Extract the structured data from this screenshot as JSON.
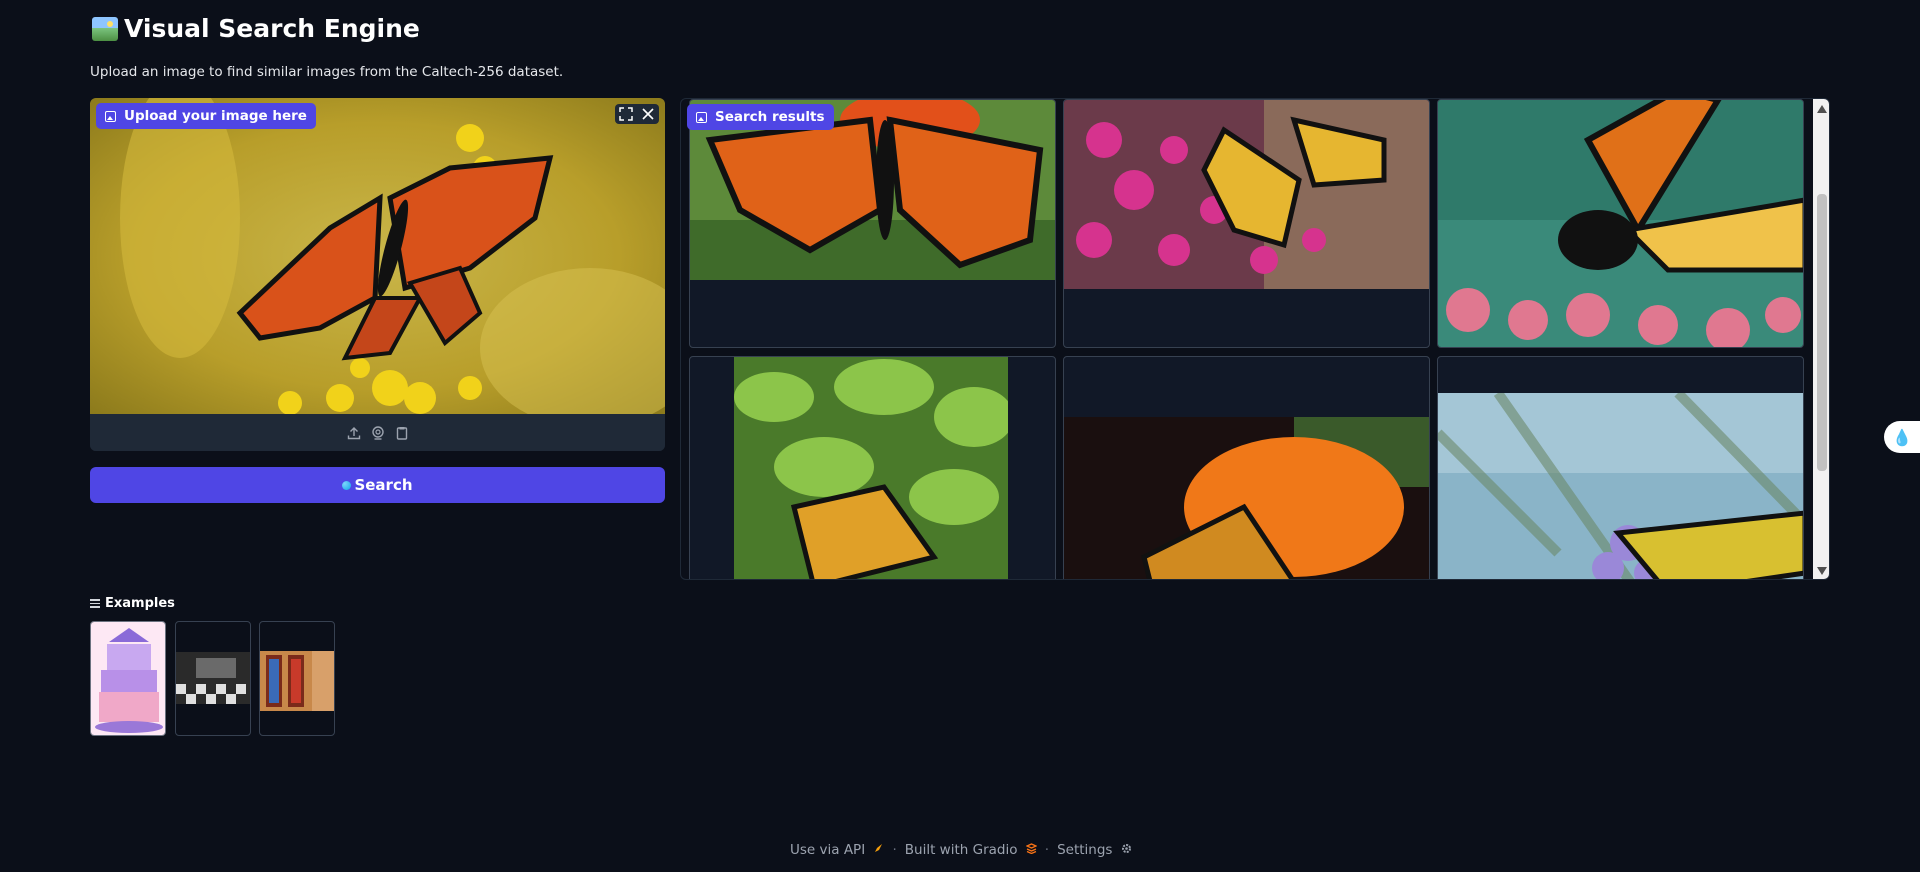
{
  "header": {
    "title": "Visual Search Engine",
    "icon": "framed-picture-icon",
    "subtitle": "Upload an image to find similar images from the Caltech-256 dataset."
  },
  "upload_panel": {
    "label": "Upload your image here",
    "image_subject": "monarch butterfly on yellow goldenrod",
    "controls": [
      "fullscreen-icon",
      "close-icon"
    ],
    "sources": [
      "upload-icon",
      "webcam-icon",
      "clipboard-icon"
    ]
  },
  "search_button": {
    "label": "Search"
  },
  "results": {
    "label": "Search results",
    "items": [
      {
        "subject": "monarch butterfly on orange flower"
      },
      {
        "subject": "monarch butterfly on pink flowers"
      },
      {
        "subject": "monarch butterfly close-up on pink flowers"
      },
      {
        "subject": "butterfly among green leaves"
      },
      {
        "subject": "tiger butterfly on orange flower"
      },
      {
        "subject": "yellow butterfly on purple flowers"
      }
    ]
  },
  "examples": {
    "label": "Examples",
    "items": [
      {
        "subject": "carousel cake"
      },
      {
        "subject": "dark room with checkered floor"
      },
      {
        "subject": "stained glass door"
      }
    ]
  },
  "footer": {
    "api": "Use via API",
    "built": "Built with Gradio",
    "settings": "Settings",
    "separator": "·"
  },
  "colors": {
    "background": "#0b0f19",
    "accent": "#4f46e5",
    "panel": "#1f2937"
  }
}
